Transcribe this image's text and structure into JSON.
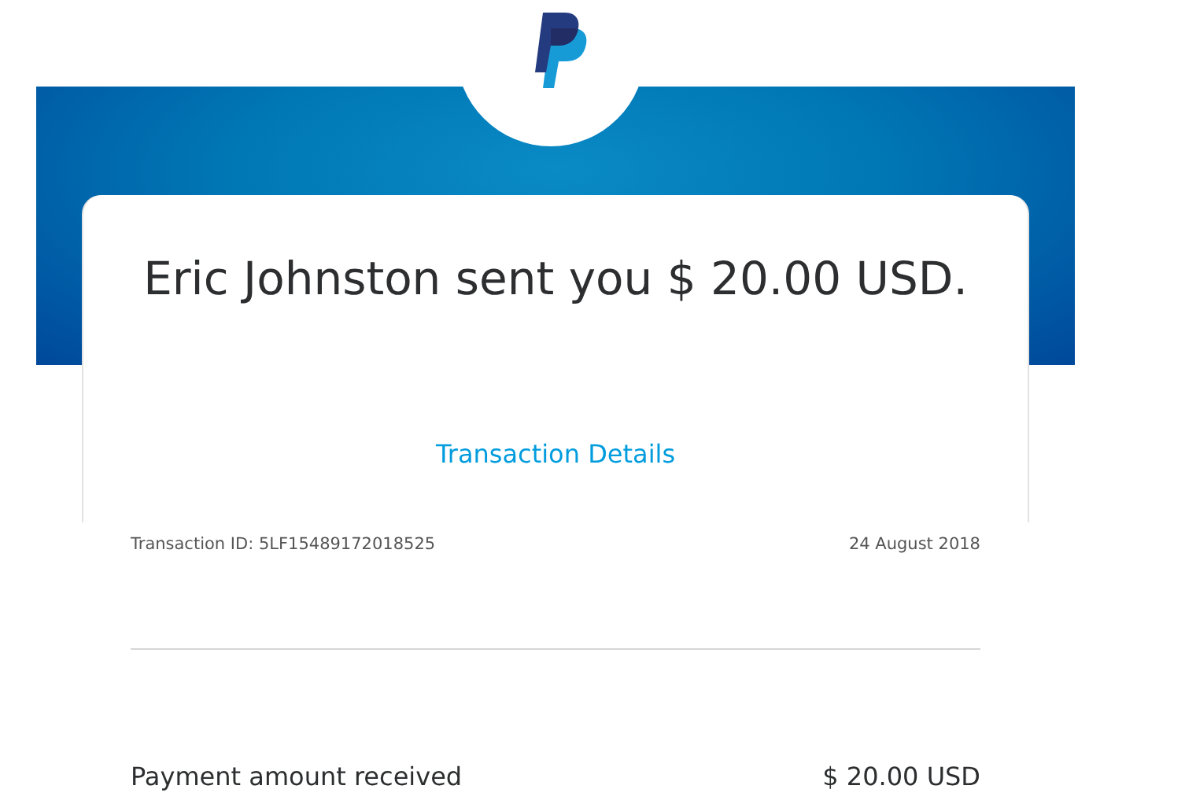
{
  "headline": "Eric Johnston sent you $ 20.00 USD.",
  "details_link": "Transaction Details",
  "transaction": {
    "id_label": "Transaction ID: 5LF15489172018525",
    "date": "24 August 2018"
  },
  "summary": [
    {
      "label": "Payment amount received",
      "amount": "$ 20.00 USD"
    }
  ]
}
